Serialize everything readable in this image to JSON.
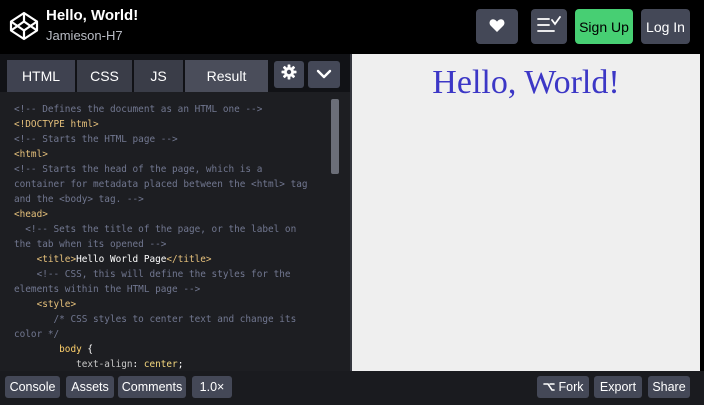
{
  "header": {
    "pen_title": "Hello, World!",
    "author": "Jamieson-H7",
    "signup_label": "Sign Up",
    "login_label": "Log In",
    "accent_color": "#47cf73"
  },
  "tabs": {
    "html": "HTML",
    "css": "CSS",
    "js": "JS",
    "result": "Result"
  },
  "code_lines": [
    [
      {
        "t": "<!-- Defines the document as an HTML one -->",
        "c": "c-com"
      }
    ],
    [
      {
        "t": "<!DOCTYPE html>",
        "c": "c-tag"
      }
    ],
    [
      {
        "t": "<!-- Starts the HTML page -->",
        "c": "c-com"
      }
    ],
    [
      {
        "t": "<html>",
        "c": "c-tag"
      }
    ],
    [
      {
        "t": "<!-- Starts the head of the page, which is a",
        "c": "c-com"
      }
    ],
    [
      {
        "t": "container for metadata placed between the <html> tag",
        "c": "c-com"
      }
    ],
    [
      {
        "t": "and the <body> tag. -->",
        "c": "c-com"
      }
    ],
    [
      {
        "t": "<head>",
        "c": "c-tag"
      }
    ],
    [
      {
        "t": "  <!-- Sets the title of the page, or the label on",
        "c": "c-com"
      }
    ],
    [
      {
        "t": "the tab when its opened -->",
        "c": "c-com"
      }
    ],
    [
      {
        "t": "    <title>",
        "c": "c-tag"
      },
      {
        "t": "Hello World Page",
        "c": "c-txt"
      },
      {
        "t": "</title>",
        "c": "c-tag"
      }
    ],
    [
      {
        "t": "    <!-- CSS, this will define the styles for the",
        "c": "c-com"
      }
    ],
    [
      {
        "t": "elements within the HTML page -->",
        "c": "c-com"
      }
    ],
    [
      {
        "t": "    <style>",
        "c": "c-tag"
      }
    ],
    [
      {
        "t": "       /* CSS styles to center text and change its",
        "c": "c-com"
      }
    ],
    [
      {
        "t": "color */",
        "c": "c-com"
      }
    ],
    [
      {
        "t": "        body ",
        "c": "c-sel"
      },
      {
        "t": "{",
        "c": "c-txt"
      }
    ],
    [
      {
        "t": "           text-align",
        "c": "c-prop"
      },
      {
        "t": ": ",
        "c": "c-txt"
      },
      {
        "t": "center",
        "c": "c-val"
      },
      {
        "t": ";",
        "c": "c-txt"
      }
    ]
  ],
  "preview": {
    "heading": "Hello, World!",
    "heading_color": "#3c37c6"
  },
  "footer": {
    "console": "Console",
    "assets": "Assets",
    "comments": "Comments",
    "zoom": "1.0×",
    "fork": "Fork",
    "export": "Export",
    "share": "Share"
  },
  "icons": {
    "logo": "codepen-logo-icon",
    "heart": "heart-icon",
    "collections": "add-to-collection-icon",
    "settings": "gear-icon",
    "chevron": "chevron-down-icon",
    "fork": "fork-icon"
  }
}
